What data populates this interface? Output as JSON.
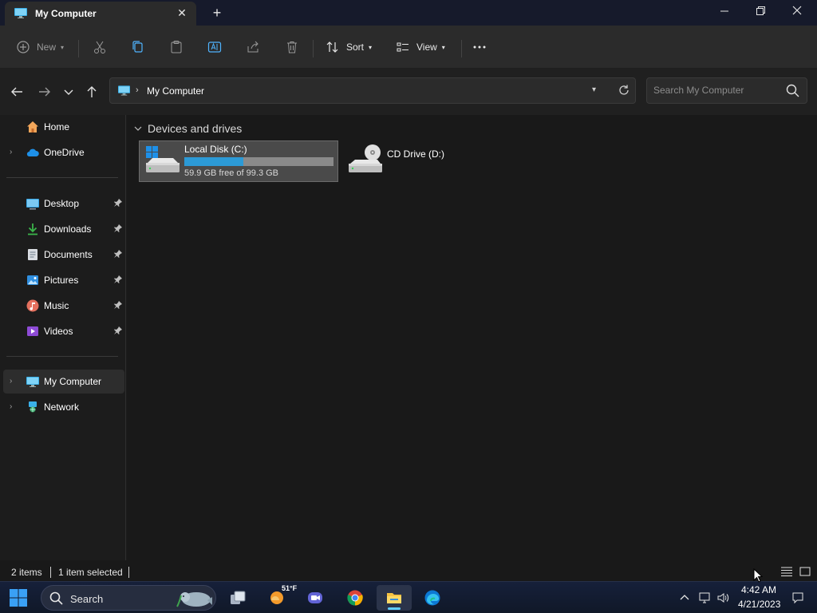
{
  "window": {
    "tab_title": "My Computer",
    "tab_icon": "computer-icon",
    "controls": [
      "minimize-icon",
      "restore-icon",
      "close-icon"
    ]
  },
  "toolbar": {
    "new_label": "New",
    "sort_label": "Sort",
    "view_label": "View",
    "icons": [
      "new-icon",
      "cut-icon",
      "copy-icon",
      "paste-icon",
      "rename-icon",
      "share-icon",
      "delete-icon",
      "sort-icon",
      "view-icon",
      "more-icon"
    ]
  },
  "address": {
    "location": "My Computer",
    "search_placeholder": "Search My Computer"
  },
  "sidebar": {
    "items": [
      {
        "label": "Home",
        "icon": "home-icon",
        "expandable": false,
        "pinned": false
      },
      {
        "label": "OneDrive",
        "icon": "cloud-icon",
        "expandable": true,
        "pinned": false
      },
      {
        "label": "Desktop",
        "icon": "desktop-icon",
        "expandable": false,
        "pinned": true
      },
      {
        "label": "Downloads",
        "icon": "download-icon",
        "expandable": false,
        "pinned": true
      },
      {
        "label": "Documents",
        "icon": "document-icon",
        "expandable": false,
        "pinned": true
      },
      {
        "label": "Pictures",
        "icon": "picture-icon",
        "expandable": false,
        "pinned": true
      },
      {
        "label": "Music",
        "icon": "music-icon",
        "expandable": false,
        "pinned": true
      },
      {
        "label": "Videos",
        "icon": "video-icon",
        "expandable": false,
        "pinned": true
      },
      {
        "label": "My Computer",
        "icon": "computer-icon",
        "expandable": true,
        "pinned": false,
        "selected": true
      },
      {
        "label": "Network",
        "icon": "network-icon",
        "expandable": true,
        "pinned": false
      }
    ]
  },
  "main": {
    "group_title": "Devices and drives",
    "drives": [
      {
        "name": "Local Disk (C:)",
        "free_text": "59.9 GB free of 99.3 GB",
        "used_fraction": 0.397,
        "selected": true
      },
      {
        "name": "CD Drive (D:)"
      }
    ]
  },
  "status": {
    "items_count": "2 items",
    "selection": "1 item selected"
  },
  "taskbar": {
    "search_label": "Search",
    "weather_temp": "51°F",
    "apps": [
      "task-view-icon",
      "weather-icon",
      "teams-icon",
      "chrome-icon",
      "file-explorer-icon",
      "edge-icon"
    ],
    "clock_time": "4:42 AM",
    "clock_date": "4/21/2023"
  },
  "colors": {
    "accent": "#2c9ad6",
    "taskbar_indicator": "#60cdff"
  }
}
